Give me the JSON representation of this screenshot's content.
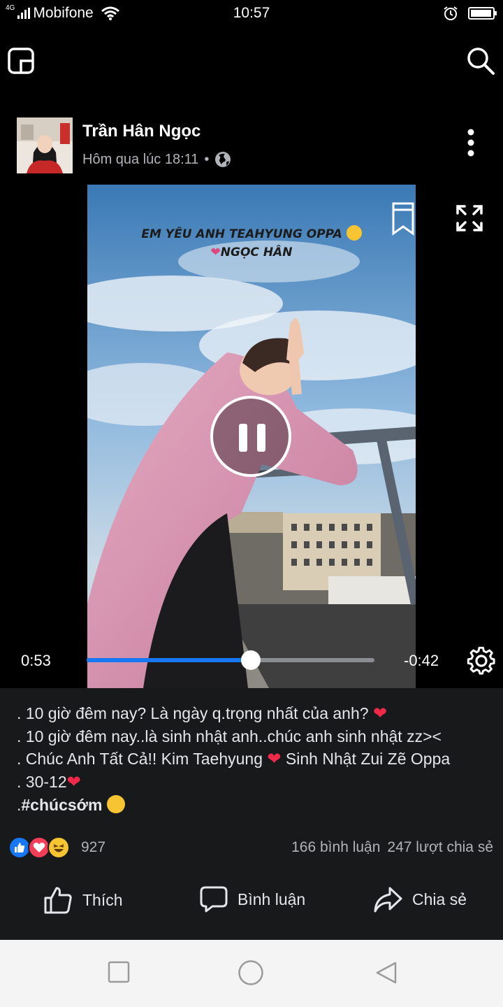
{
  "status_bar": {
    "network": "4G",
    "carrier": "Mobifone",
    "time": "10:57",
    "battery_level_percent": 90
  },
  "app_bar": {
    "left_icon": "pip-icon",
    "right_icon": "search-icon"
  },
  "post": {
    "author": "Trần Hân Ngọc",
    "timestamp": "Hôm qua lúc 18:11",
    "separator": "•",
    "privacy_icon": "globe-icon"
  },
  "video": {
    "overlay_line1": "EM YÊU ANH TEAHYUNG OPPA",
    "overlay_line2": "NGỌC HÂN",
    "current_time": "0:53",
    "remaining_time": "-0:42",
    "progress_fraction": 0.57,
    "state": "playing",
    "accent_color": "#1877f2"
  },
  "post_text": {
    "line1": ". 10 giờ đêm nay?  Là ngày q.trọng nhất của anh?",
    "line2": ". 10 giờ đêm nay..là sinh nhật anh..chúc anh sinh nhật zz><",
    "line3a": ". Chúc Anh Tất Cả!!  Kim Taehyung",
    "line3b": "Sinh Nhật Zui Zẽ Oppa",
    "line4": ". 30-12",
    "line5_prefix": ".",
    "hashtag": "#chúcsớm",
    "heart": "❤"
  },
  "reactions": {
    "count": "927",
    "comments": "166 bình luận",
    "shares": "247 lượt chia sẻ",
    "like_color": "#1877f2",
    "love_color": "#f33e58",
    "haha_color": "#f7c531"
  },
  "actions": {
    "like": "Thích",
    "comment": "Bình luận",
    "share": "Chia sẻ"
  }
}
